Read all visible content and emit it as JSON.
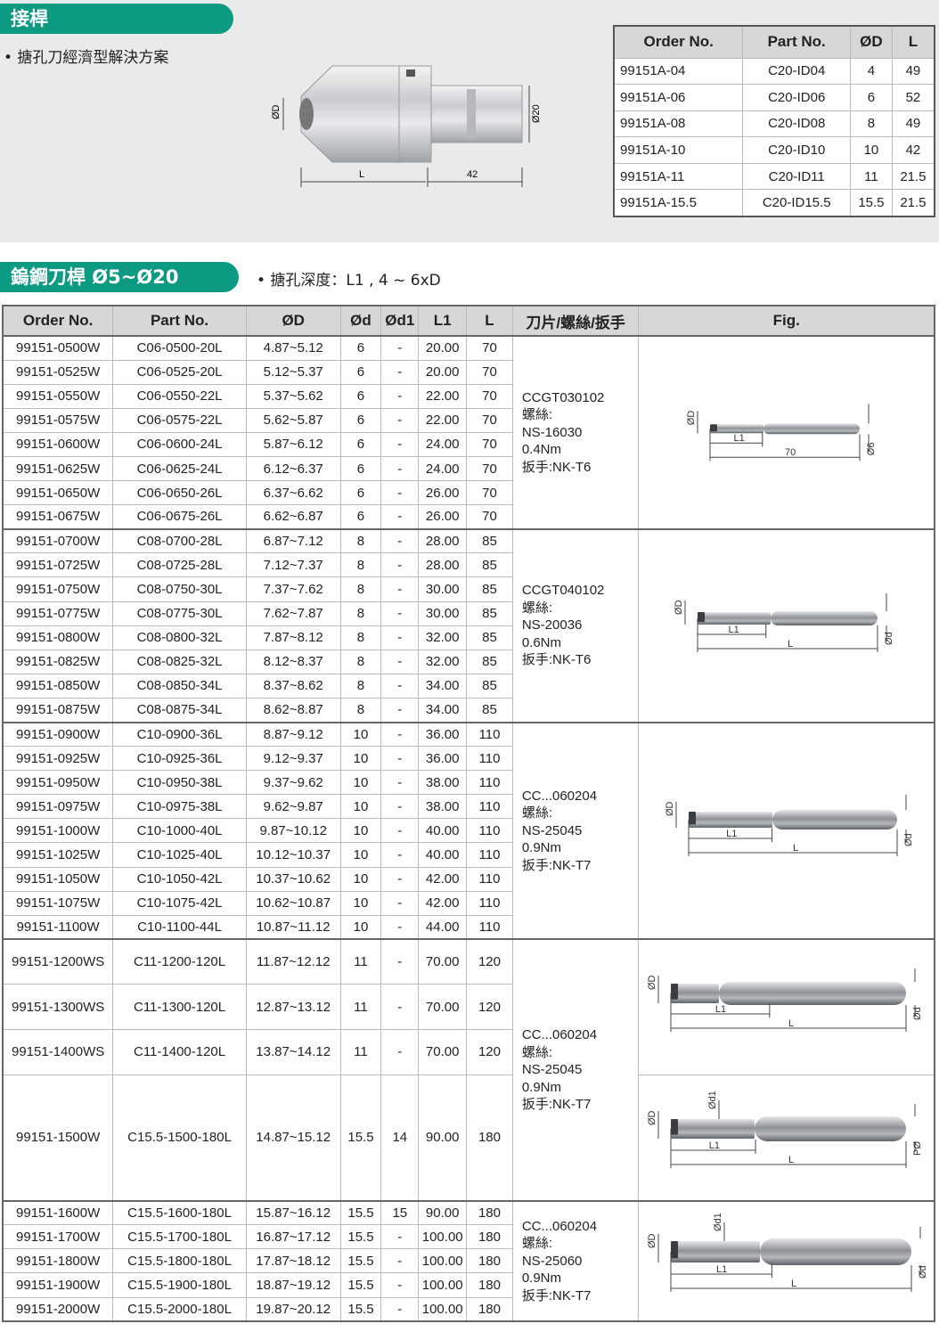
{
  "top": {
    "section_title": "接桿",
    "bullet": "• 搪孔刀經濟型解決方案",
    "illustration": {
      "dim_d": "ØD",
      "dim_20": "Ø20",
      "dim_l": "L",
      "dim_42": "42"
    },
    "table": {
      "headers": [
        "Order No.",
        "Part No.",
        "ØD",
        "L"
      ],
      "rows": [
        [
          "99151A-04",
          "C20-ID04",
          "4",
          "49"
        ],
        [
          "99151A-06",
          "C20-ID06",
          "6",
          "52"
        ],
        [
          "99151A-08",
          "C20-ID08",
          "8",
          "49"
        ],
        [
          "99151A-10",
          "C20-ID10",
          "10",
          "42"
        ],
        [
          "99151A-11",
          "C20-ID11",
          "11",
          "21.5"
        ],
        [
          "99151A-15.5",
          "C20-ID15.5",
          "15.5",
          "21.5"
        ]
      ]
    }
  },
  "bottom": {
    "section_title": "鎢鋼刀桿 Ø5~Ø20",
    "bullet": "• 搪孔深度：L1 , 4 ~ 6xD",
    "headers": [
      "Order No.",
      "Part No.",
      "ØD",
      "Ød",
      "Ød1",
      "L1",
      "L",
      "刀片/螺絲/扳手",
      "Fig."
    ],
    "groups": [
      {
        "info": [
          "CCGT030102",
          "螺絲:",
          "NS-16030",
          "0.4Nm",
          "扳手:NK-T6"
        ],
        "fig": {
          "d": "ØD",
          "l1": "L1",
          "l": "70",
          "dd": "Ø6"
        },
        "rows": [
          [
            "99151-0500W",
            "C06-0500-20L",
            "4.87~5.12",
            "6",
            "-",
            "20.00",
            "70"
          ],
          [
            "99151-0525W",
            "C06-0525-20L",
            "5.12~5.37",
            "6",
            "-",
            "20.00",
            "70"
          ],
          [
            "99151-0550W",
            "C06-0550-22L",
            "5.37~5.62",
            "6",
            "-",
            "22.00",
            "70"
          ],
          [
            "99151-0575W",
            "C06-0575-22L",
            "5.62~5.87",
            "6",
            "-",
            "22.00",
            "70"
          ],
          [
            "99151-0600W",
            "C06-0600-24L",
            "5.87~6.12",
            "6",
            "-",
            "24.00",
            "70"
          ],
          [
            "99151-0625W",
            "C06-0625-24L",
            "6.12~6.37",
            "6",
            "-",
            "24.00",
            "70"
          ],
          [
            "99151-0650W",
            "C06-0650-26L",
            "6.37~6.62",
            "6",
            "-",
            "26.00",
            "70"
          ],
          [
            "99151-0675W",
            "C06-0675-26L",
            "6.62~6.87",
            "6",
            "-",
            "26.00",
            "70"
          ]
        ]
      },
      {
        "info": [
          "CCGT040102",
          "螺絲:",
          "NS-20036",
          "0.6Nm",
          "扳手:NK-T6"
        ],
        "fig": {
          "d": "ØD",
          "l1": "L1",
          "l": "L",
          "dd": "Ød"
        },
        "rows": [
          [
            "99151-0700W",
            "C08-0700-28L",
            "6.87~7.12",
            "8",
            "-",
            "28.00",
            "85"
          ],
          [
            "99151-0725W",
            "C08-0725-28L",
            "7.12~7.37",
            "8",
            "-",
            "28.00",
            "85"
          ],
          [
            "99151-0750W",
            "C08-0750-30L",
            "7.37~7.62",
            "8",
            "-",
            "30.00",
            "85"
          ],
          [
            "99151-0775W",
            "C08-0775-30L",
            "7.62~7.87",
            "8",
            "-",
            "30.00",
            "85"
          ],
          [
            "99151-0800W",
            "C08-0800-32L",
            "7.87~8.12",
            "8",
            "-",
            "32.00",
            "85"
          ],
          [
            "99151-0825W",
            "C08-0825-32L",
            "8.12~8.37",
            "8",
            "-",
            "32.00",
            "85"
          ],
          [
            "99151-0850W",
            "C08-0850-34L",
            "8.37~8.62",
            "8",
            "-",
            "34.00",
            "85"
          ],
          [
            "99151-0875W",
            "C08-0875-34L",
            "8.62~8.87",
            "8",
            "-",
            "34.00",
            "85"
          ]
        ]
      },
      {
        "info": [
          "CC...060204",
          "螺絲:",
          "NS-25045",
          "0.9Nm",
          "扳手:NK-T7"
        ],
        "fig": {
          "d": "ØD",
          "l1": "L1",
          "l": "L",
          "dd": "Ød"
        },
        "rows": [
          [
            "99151-0900W",
            "C10-0900-36L",
            "8.87~9.12",
            "10",
            "-",
            "36.00",
            "110"
          ],
          [
            "99151-0925W",
            "C10-0925-36L",
            "9.12~9.37",
            "10",
            "-",
            "36.00",
            "110"
          ],
          [
            "99151-0950W",
            "C10-0950-38L",
            "9.37~9.62",
            "10",
            "-",
            "38.00",
            "110"
          ],
          [
            "99151-0975W",
            "C10-0975-38L",
            "9.62~9.87",
            "10",
            "-",
            "38.00",
            "110"
          ],
          [
            "99151-1000W",
            "C10-1000-40L",
            "9.87~10.12",
            "10",
            "-",
            "40.00",
            "110"
          ],
          [
            "99151-1025W",
            "C10-1025-40L",
            "10.12~10.37",
            "10",
            "-",
            "40.00",
            "110"
          ],
          [
            "99151-1050W",
            "C10-1050-42L",
            "10.37~10.62",
            "10",
            "-",
            "42.00",
            "110"
          ],
          [
            "99151-1075W",
            "C10-1075-42L",
            "10.62~10.87",
            "10",
            "-",
            "42.00",
            "110"
          ],
          [
            "99151-1100W",
            "C10-1100-44L",
            "10.87~11.12",
            "10",
            "-",
            "44.00",
            "110"
          ]
        ]
      },
      {
        "info": [
          "CC...060204",
          "螺絲:",
          "NS-25045",
          "0.9Nm",
          "扳手:NK-T7"
        ],
        "fig": {
          "d": "ØD",
          "l1": "L1",
          "l": "L",
          "dd": "Ød"
        },
        "fig2": {
          "d": "ØD",
          "d1": "Ød1",
          "l1": "L1",
          "l": "L",
          "dd": "PØ"
        },
        "rows": [
          [
            "99151-1200WS",
            "C11-1200-120L",
            "11.87~12.12",
            "11",
            "-",
            "70.00",
            "120"
          ],
          [
            "99151-1300WS",
            "C11-1300-120L",
            "12.87~13.12",
            "11",
            "-",
            "70.00",
            "120"
          ],
          [
            "99151-1400WS",
            "C11-1400-120L",
            "13.87~14.12",
            "11",
            "-",
            "70.00",
            "120"
          ],
          [
            "99151-1500W",
            "C15.5-1500-180L",
            "14.87~15.12",
            "15.5",
            "14",
            "90.00",
            "180"
          ]
        ]
      },
      {
        "info": [
          "CC...060204",
          "螺絲:",
          "NS-25060",
          "0.9Nm",
          "扳手:NK-T7"
        ],
        "fig": {
          "d": "ØD",
          "d1": "Ød1",
          "l1": "L1",
          "l": "L",
          "dd": "Ød"
        },
        "rows": [
          [
            "99151-1600W",
            "C15.5-1600-180L",
            "15.87~16.12",
            "15.5",
            "15",
            "90.00",
            "180"
          ],
          [
            "99151-1700W",
            "C15.5-1700-180L",
            "16.87~17.12",
            "15.5",
            "-",
            "100.00",
            "180"
          ],
          [
            "99151-1800W",
            "C15.5-1800-180L",
            "17.87~18.12",
            "15.5",
            "-",
            "100.00",
            "180"
          ],
          [
            "99151-1900W",
            "C15.5-1900-180L",
            "18.87~19.12",
            "15.5",
            "-",
            "100.00",
            "180"
          ],
          [
            "99151-2000W",
            "C15.5-2000-180L",
            "19.87~20.12",
            "15.5",
            "-",
            "100.00",
            "180"
          ]
        ]
      }
    ]
  }
}
